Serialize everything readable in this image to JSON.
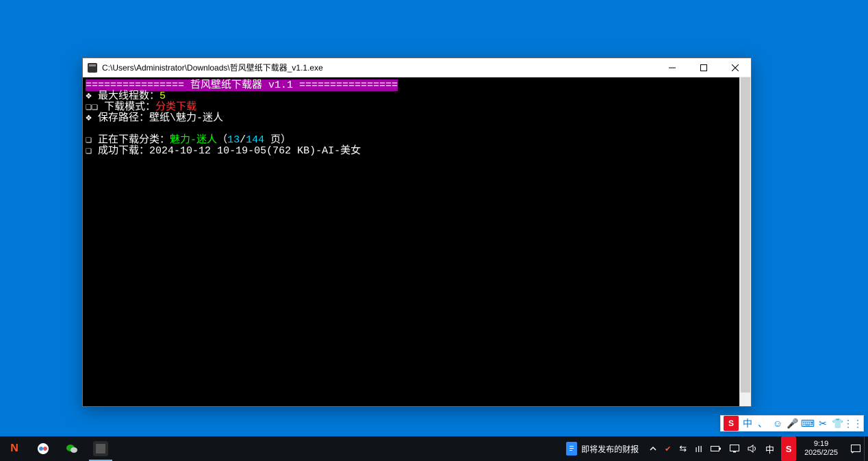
{
  "window": {
    "title": "C:\\Users\\Administrator\\Downloads\\哲风壁纸下载器_v1.1.exe",
    "app_icon": "terminal-app-icon"
  },
  "terminal": {
    "header_border": "================",
    "header_title": " 哲风壁纸下载器 v1.1 ",
    "line1_marker": "❖",
    "line1_label": " 最大线程数：",
    "line1_value": "5",
    "line2_marker": "❏❏",
    "line2_label": " 下载模式：",
    "line2_value": "分类下载",
    "line3_marker": "❖",
    "line3_label": " 保存路径：",
    "line3_value": "壁纸\\魅力-迷人",
    "dl_marker": "❏",
    "dl_prefix": " 正在下载分类：",
    "dl_category": "魅力-迷人",
    "dl_paren_open": "（",
    "dl_current": "13",
    "dl_slash": "/",
    "dl_total": "144",
    "dl_pages": " 页",
    "dl_paren_close": "）",
    "ok_marker": "❏",
    "ok_prefix": " 成功下载：",
    "ok_text": "2024-10-12 10-19-05(762 KB)-AI-美女"
  },
  "ime": {
    "logo": "S",
    "items": [
      "中",
      "、",
      "☺",
      "🎤",
      "⌨",
      "✂",
      "👕",
      "⋮⋮"
    ]
  },
  "taskbar": {
    "news": "即将发布的财报",
    "time": "9:19",
    "date": "2025/2/25",
    "lang": "中"
  }
}
